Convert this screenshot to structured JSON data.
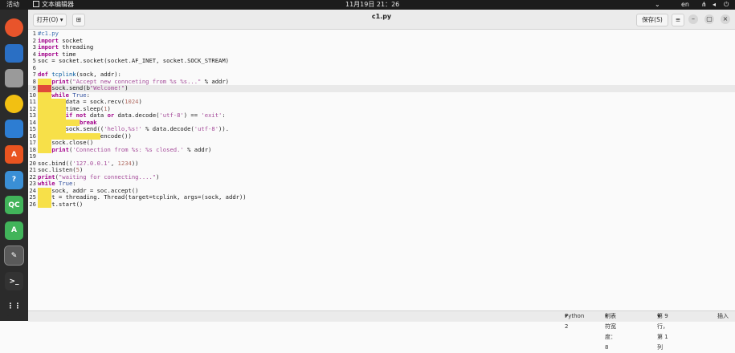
{
  "topbar": {
    "activities": "活动",
    "app_name": "文本编辑器",
    "clock": "11月19日 21：26",
    "lang": "en"
  },
  "header": {
    "open_label": "打开(O)",
    "open_arrow": "▾",
    "title": "c1.py",
    "save_label": "保存(S)",
    "menu_icon": "≡",
    "min_icon": "–",
    "max_icon": "▢",
    "close_icon": "×"
  },
  "dock": {
    "items": [
      {
        "name": "firefox-icon",
        "color": "#e8542b"
      },
      {
        "name": "thunderbird-icon",
        "color": "#2a6fc4"
      },
      {
        "name": "files-icon",
        "color": "#9a9a9a"
      },
      {
        "name": "rhythmbox-icon",
        "color": "#f2c012"
      },
      {
        "name": "writer-icon",
        "color": "#2d7dd2"
      },
      {
        "name": "app-center-icon",
        "color": "#e95420",
        "glyph": "A"
      },
      {
        "name": "help-icon",
        "color": "#3a8fd6",
        "glyph": "?"
      },
      {
        "name": "qt-creator-icon",
        "color": "#41b45a",
        "glyph": "QC"
      },
      {
        "name": "qt-assistant-icon",
        "color": "#41b45a",
        "glyph": "A"
      },
      {
        "name": "text-editor-icon",
        "color": "#5a5a5a",
        "glyph": "✎"
      },
      {
        "name": "terminal-icon",
        "color": "#333333",
        "glyph": ">_"
      },
      {
        "name": "show-apps-icon",
        "color": "#2b2b2b",
        "glyph": "⋮⋮"
      }
    ]
  },
  "code": {
    "lines": [
      "#c1.py",
      "import socket",
      "import threading",
      "import time",
      "soc = socket.socket(socket.AF_INET, socket.SOCK_STREAM)",
      "",
      "def tcplink(sock, addr):",
      "    print(\"Accept new connceting from %s %s...\" % addr)",
      "    sock.send(b\"Welcome!\")",
      "    while True:",
      "        data = sock.recv(1024)",
      "        time.sleep(1)",
      "        if not data or data.decode('utf-8') == 'exit':",
      "            break",
      "        sock.send(('hello,%s!' % data.decode('utf-8')).",
      "                  encode())",
      "    sock.close()",
      "    print('Connection from %s: %s closed.' % addr)",
      "",
      "soc.bind(('127.0.0.1', 1234))",
      "soc.listen(5)",
      "print(\"waiting for connecting....\")",
      "while True:",
      "    sock, addr = soc.accept()",
      "    t = threading. Thread(target=tcplink, args=(sock, addr))",
      "    t.start()"
    ]
  },
  "status": {
    "language": "Python 2",
    "tab_width": "制表符宽度：8",
    "position": "第 9 行，第 1 列",
    "mode": "插入"
  }
}
